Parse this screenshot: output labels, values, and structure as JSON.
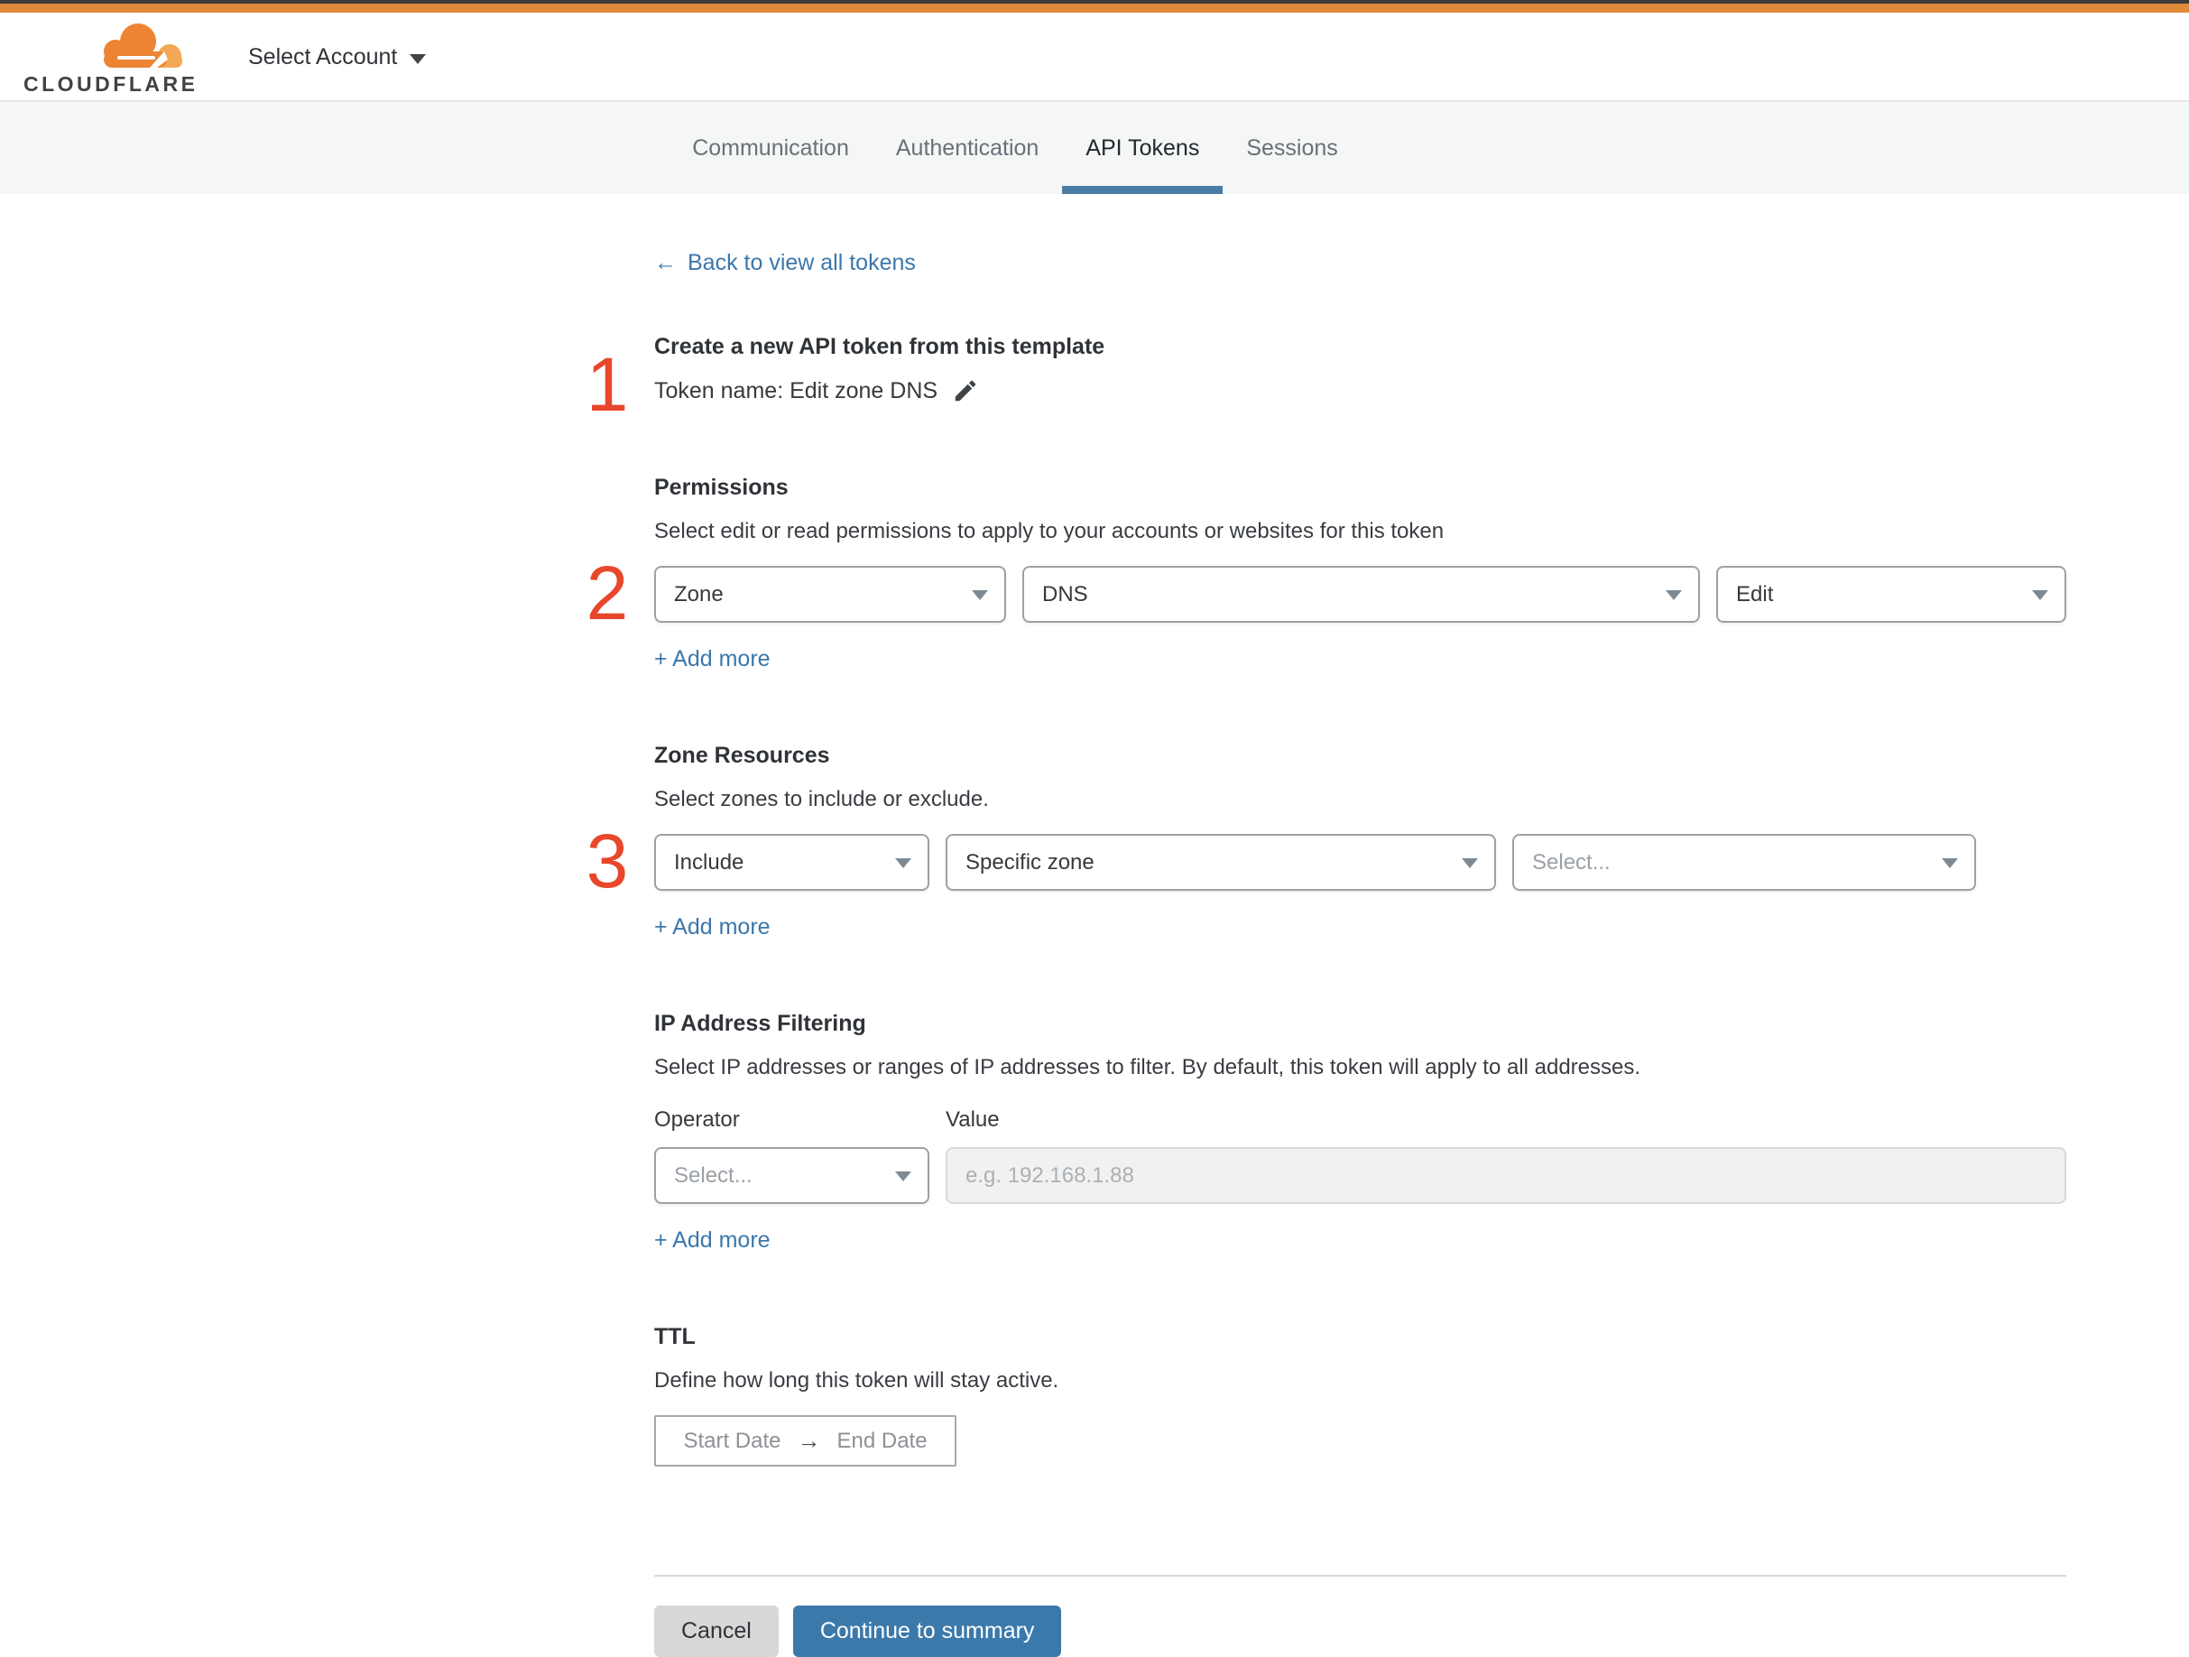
{
  "brand": {
    "name": "CLOUDFLARE"
  },
  "header": {
    "account_selector": "Select Account"
  },
  "tabs": {
    "items": [
      {
        "label": "Communication",
        "active": false
      },
      {
        "label": "Authentication",
        "active": false
      },
      {
        "label": "API Tokens",
        "active": true
      },
      {
        "label": "Sessions",
        "active": false
      }
    ]
  },
  "back_link": {
    "arrow": "←",
    "label": "Back to view all tokens"
  },
  "step1": {
    "number": "1",
    "title": "Create a new API token from this template",
    "token_name_label": "Token name: Edit zone DNS"
  },
  "permissions": {
    "number": "2",
    "title": "Permissions",
    "description": "Select edit or read permissions to apply to your accounts or websites for this token",
    "scope_value": "Zone",
    "resource_value": "DNS",
    "access_value": "Edit",
    "add_more": "+ Add more"
  },
  "zone_resources": {
    "number": "3",
    "title": "Zone Resources",
    "description": "Select zones to include or exclude.",
    "operator_value": "Include",
    "type_value": "Specific zone",
    "zone_placeholder": "Select...",
    "add_more": "+ Add more"
  },
  "ip_filtering": {
    "title": "IP Address Filtering",
    "description": "Select IP addresses or ranges of IP addresses to filter. By default, this token will apply to all addresses.",
    "operator_label": "Operator",
    "value_label": "Value",
    "operator_placeholder": "Select...",
    "value_placeholder": "e.g. 192.168.1.88",
    "add_more": "+ Add more"
  },
  "ttl": {
    "title": "TTL",
    "description": "Define how long this token will stay active.",
    "start_label": "Start Date",
    "range_arrow": "→",
    "end_label": "End Date"
  },
  "footer": {
    "cancel_label": "Cancel",
    "continue_label": "Continue to summary"
  },
  "icons": {
    "edit_pencil": "pencil-icon",
    "dropdown_caret": "chevron-down-icon",
    "account_chevron": "chevron-down-icon",
    "back_arrow": "left-arrow-icon",
    "range_arrow": "right-arrow-icon",
    "logo_cloud": "cloudflare-cloud-icon"
  },
  "colors": {
    "topbar_orange": "#e08b3a",
    "topbar_dark": "#3b3b3b",
    "marker_red": "#e8472b",
    "link_blue": "#3b77ac",
    "tab_underline_blue": "#4a7ca6",
    "continue_button_blue": "#3c79ab",
    "cancel_button_gray": "#d7d7d7",
    "disabled_input_bg": "#f1f1f1",
    "tab_band_bg": "#f5f6f6"
  }
}
